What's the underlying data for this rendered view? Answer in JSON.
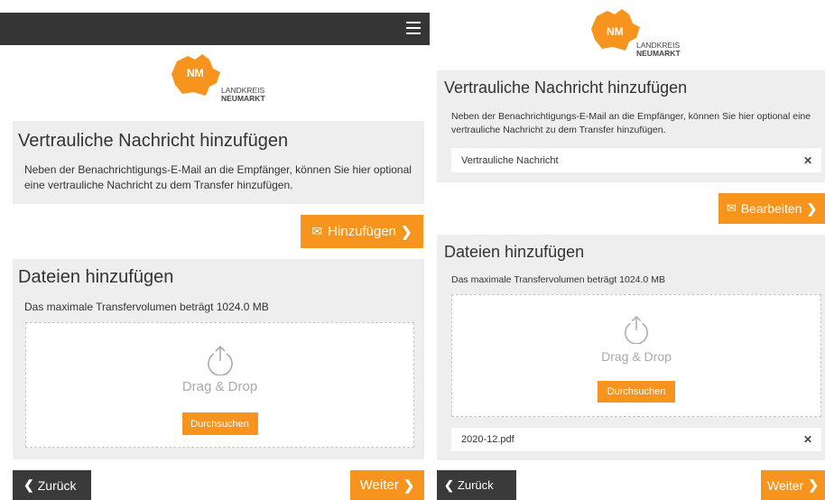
{
  "logo": {
    "initials": "NM",
    "line1": "LANDKREIS",
    "line2": "NEUMARKT"
  },
  "message": {
    "title": "Vertrauliche Nachricht hinzufügen",
    "description": "Neben der Benachrichtigungs-E-Mail an die Empfänger, können Sie hier optional eine vertrauliche Nachricht zu dem Transfer hinzufügen.",
    "add_label": "Hinzufügen",
    "edit_label": "Bearbeiten",
    "field_value": "Vertrauliche Nachricht"
  },
  "files": {
    "title": "Dateien hinzufügen",
    "limit_text": "Das maximale Transfervolumen beträgt 1024.0 MB",
    "drop_text": "Drag & Drop",
    "browse_label": "Durchsuchen",
    "uploaded_file": "2020-12.pdf"
  },
  "nav": {
    "back_label": "Zurück",
    "next_label": "Weiter"
  },
  "colors": {
    "accent": "#f7941d",
    "topbar": "#353535",
    "panel_bg": "#eeeeee"
  }
}
